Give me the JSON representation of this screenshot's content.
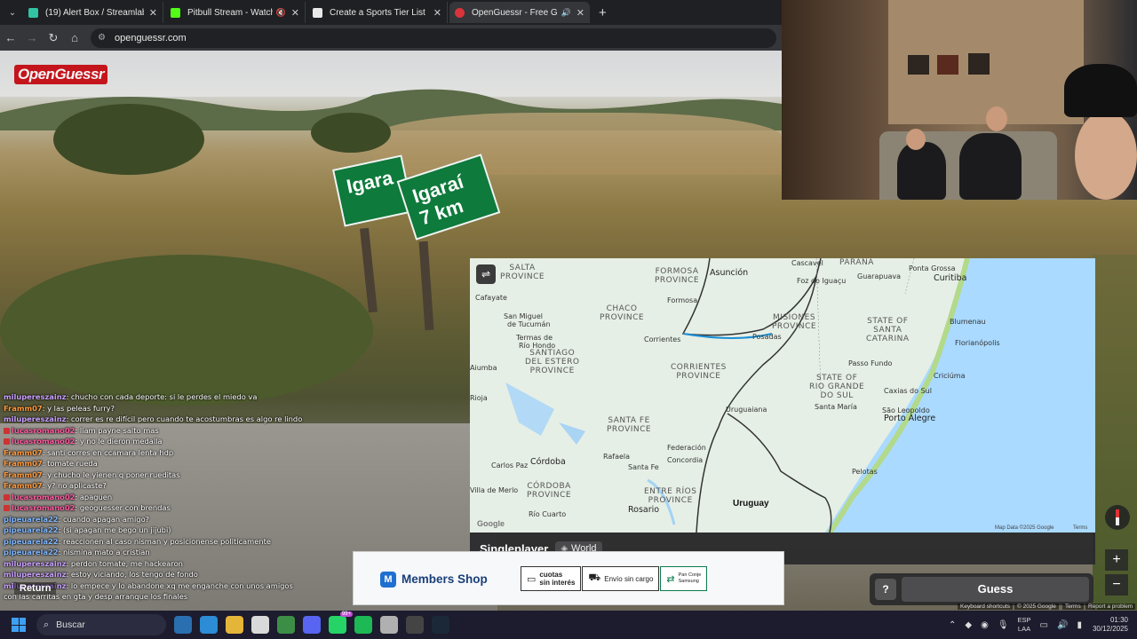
{
  "browser": {
    "tabs": [
      {
        "title": "(19) Alert Box / Streamlabs",
        "icon": "streamlabs-icon",
        "color": "#31c3a2"
      },
      {
        "title": "Pitbull Stream - Watch Live",
        "icon": "kick-icon",
        "color": "#53fc18",
        "extra": "muted"
      },
      {
        "title": "Create a Sports Tier List - TierMaker",
        "icon": "tiermaker-icon",
        "color": "#e8e8e8"
      },
      {
        "title": "OpenGuessr - Free GeoGuessr",
        "icon": "openguessr-icon",
        "color": "#d8343a",
        "active": true
      }
    ],
    "url": "openguessr.com"
  },
  "game": {
    "logo": "OpenGuessr",
    "signs": [
      "Igara",
      "Igaraí 7 km"
    ],
    "mode": "Singleplayer",
    "region": "World",
    "guess_label": "Guess",
    "help_label": "?",
    "return_label": "Return",
    "zoom_in": "+",
    "zoom_out": "−"
  },
  "map": {
    "regions": [
      "SALTA\nPROVINCE",
      "FORMOSA\nPROVINCE",
      "PARANÁ",
      "CHACO\nPROVINCE",
      "MISIONES\nPROVINCE",
      "STATE OF\nSANTA\nCATARINA",
      "SANTIAGO\nDEL ESTERO\nPROVINCE",
      "CORRIENTES\nPROVINCE",
      "STATE OF\nRIO GRANDE\nDO SUL",
      "SANTA FE\nPROVINCE",
      "CÓRDOBA\nPROVINCE",
      "ENTRE RÍOS\nPROVINCE"
    ],
    "cities": [
      "Asunción",
      "Cascavel",
      "Ponta Grossa",
      "Curitiba",
      "Cafayate",
      "San Miguel\nde Tucumán",
      "Formosa",
      "Foz do Iguaçu",
      "Guarapuava",
      "Blumenau",
      "Termas de\nRío Hondo",
      "Corrientes",
      "Posadas",
      "Florianópolis",
      "Passo Fundo",
      "Caxias do Sul",
      "Criciúma",
      "Uruguaiana",
      "Santa María",
      "São Leopoldo",
      "Porto Alegre",
      "Rafaela",
      "Federación",
      "Santa Fe",
      "Concordia",
      "Carlos Paz",
      "Córdoba",
      "Villa de Merlo",
      "Río Cuarto",
      "Rosario",
      "Pelotas",
      "Rioja",
      "Aiumba"
    ],
    "country_label": "Uruguay",
    "attribution": "Map Data ©2025 Google",
    "terms": "Terms",
    "google": "Google",
    "settings_icon": "sliders-icon"
  },
  "chat": [
    {
      "user": "milupereszainz",
      "msg": "chucho con cada deporte: si le perdes el miedo va",
      "color": "#c9a0ff"
    },
    {
      "user": "Framm07",
      "msg": "y las peleas furry?",
      "color": "#ff9a3c"
    },
    {
      "user": "milupereszainz",
      "msg": "correr es re difícil pero cuando te acostumbras es algo re lindo",
      "color": "#c9a0ff"
    },
    {
      "user": "lucasromano02",
      "msg": "liam payne salto mas",
      "color": "#ff5aa0",
      "badge": true
    },
    {
      "user": "lucasromano02",
      "msg": "y no le dieron medalla",
      "color": "#ff5aa0",
      "badge": true
    },
    {
      "user": "Framm07",
      "msg": "santi corres en ccamara lenta hdp",
      "color": "#ff9a3c"
    },
    {
      "user": "Framm07",
      "msg": "tomate rueda",
      "color": "#ff9a3c"
    },
    {
      "user": "Framm07",
      "msg": "y chucho le yienen q poner rueditas",
      "color": "#ff9a3c"
    },
    {
      "user": "Framm07",
      "msg": "y? no aplicaste?",
      "color": "#ff9a3c"
    },
    {
      "user": "lucasromano02",
      "msg": "apaguen",
      "color": "#ff5aa0",
      "badge": true
    },
    {
      "user": "lucasromano02",
      "msg": "geoguesser con brendas",
      "color": "#ff5aa0",
      "badge": true
    },
    {
      "user": "pipeuarela22",
      "msg": "cuando apagan amigo?",
      "color": "#7fb7ff"
    },
    {
      "user": "pipeuarela22",
      "msg": "(si apagan me bego un jijubi)",
      "color": "#7fb7ff"
    },
    {
      "user": "pipeuarela22",
      "msg": "reaccionen al caso nisman y posicionense politicamente",
      "color": "#7fb7ff"
    },
    {
      "user": "pipeuarela22",
      "msg": "nismina mato a cristian",
      "color": "#7fb7ff"
    },
    {
      "user": "milupereszainz",
      "msg": "perdon tomate, me hackearon",
      "color": "#c9a0ff"
    },
    {
      "user": "milupereszainz",
      "msg": "estoy viciando, los tengo de fondo",
      "color": "#c9a0ff"
    },
    {
      "user": "milupereszainz",
      "msg": "lo empece y lo abandone xq me enganche con unos amigos",
      "color": "#c9a0ff"
    },
    {
      "user": "",
      "msg": "con las carritas en gta y desp arranque los finales",
      "color": "#c9a0ff"
    }
  ],
  "ad": {
    "brand": "Members Shop",
    "chips": [
      "cuotas\nsin interés",
      "Envío sin cargo",
      "Pan Conje\nSamsung"
    ]
  },
  "streetview_footer": [
    "Keyboard shortcuts",
    "© 2025 Google",
    "Terms",
    "Report a problem"
  ],
  "taskbar": {
    "search": "Buscar",
    "apps": [
      {
        "name": "widgets-icon",
        "color": "#2a6fb0"
      },
      {
        "name": "edge-icon",
        "color": "#2c8cd6"
      },
      {
        "name": "file-explorer-icon",
        "color": "#e5b53a"
      },
      {
        "name": "store-icon",
        "color": "#d9d9d9"
      },
      {
        "name": "chrome-icon",
        "color": "#3c8e47"
      },
      {
        "name": "discord-icon",
        "color": "#5865f2"
      },
      {
        "name": "whatsapp-icon",
        "color": "#25d366",
        "count": "99+"
      },
      {
        "name": "spotify-icon",
        "color": "#1db954"
      },
      {
        "name": "game-icon",
        "color": "#b0b0b0"
      },
      {
        "name": "obs-icon",
        "color": "#444"
      },
      {
        "name": "steam-icon",
        "color": "#1b2838"
      }
    ],
    "lang": [
      "ESP",
      "LAA"
    ],
    "time": "01:30",
    "date": "30/12/2025"
  }
}
